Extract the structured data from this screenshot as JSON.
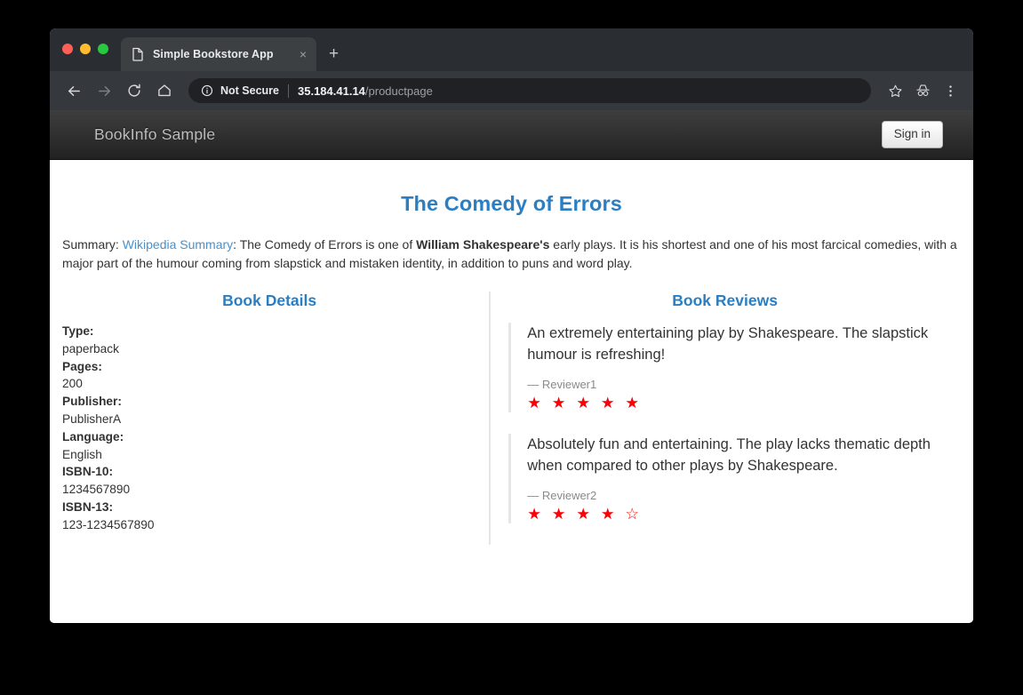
{
  "browser": {
    "tab": {
      "title": "Simple Bookstore App",
      "favicon_name": "page-icon",
      "close_glyph": "×",
      "new_tab_glyph": "+"
    },
    "toolbar": {
      "back_name": "back-arrow-icon",
      "forward_name": "forward-arrow-icon",
      "reload_name": "reload-icon",
      "home_name": "home-icon",
      "security_label": "Not Secure",
      "url_host": "35.184.41.14",
      "url_path": "/productpage",
      "bookmark_name": "star-icon",
      "incognito_name": "incognito-icon",
      "menu_name": "three-dot-menu-icon"
    }
  },
  "navbar": {
    "brand": "BookInfo Sample",
    "signin_label": "Sign in"
  },
  "page": {
    "title": "The Comedy of Errors",
    "summary": {
      "prefix": "Summary: ",
      "link_text": "Wikipedia Summary",
      "part1": ": The Comedy of Errors is one of ",
      "bold": "William Shakespeare's",
      "part2": " early plays. It is his shortest and one of his most farcical comedies, with a major part of the humour coming from slapstick and mistaken identity, in addition to puns and word play."
    },
    "details": {
      "heading": "Book Details",
      "items": [
        {
          "label": "Type:",
          "value": "paperback"
        },
        {
          "label": "Pages:",
          "value": "200"
        },
        {
          "label": "Publisher:",
          "value": "PublisherA"
        },
        {
          "label": "Language:",
          "value": "English"
        },
        {
          "label": "ISBN-10:",
          "value": "1234567890"
        },
        {
          "label": "ISBN-13:",
          "value": "123-1234567890"
        }
      ]
    },
    "reviews": {
      "heading": "Book Reviews",
      "items": [
        {
          "text": "An extremely entertaining play by Shakespeare. The slapstick humour is refreshing!",
          "author": "— Reviewer1",
          "rating": 5,
          "max_rating": 5,
          "stars": "★ ★ ★ ★ ★"
        },
        {
          "text": "Absolutely fun and entertaining. The play lacks thematic depth when compared to other plays by Shakespeare.",
          "author": "— Reviewer2",
          "rating": 4,
          "max_rating": 5,
          "stars": "★ ★ ★ ★ ☆"
        }
      ]
    }
  },
  "colors": {
    "accent_blue": "#2a7fc4",
    "link_blue": "#4a90c9",
    "star_red": "#fb0007",
    "navbar_dark": "#2a2a2a",
    "desktop_bg": "#000000"
  }
}
